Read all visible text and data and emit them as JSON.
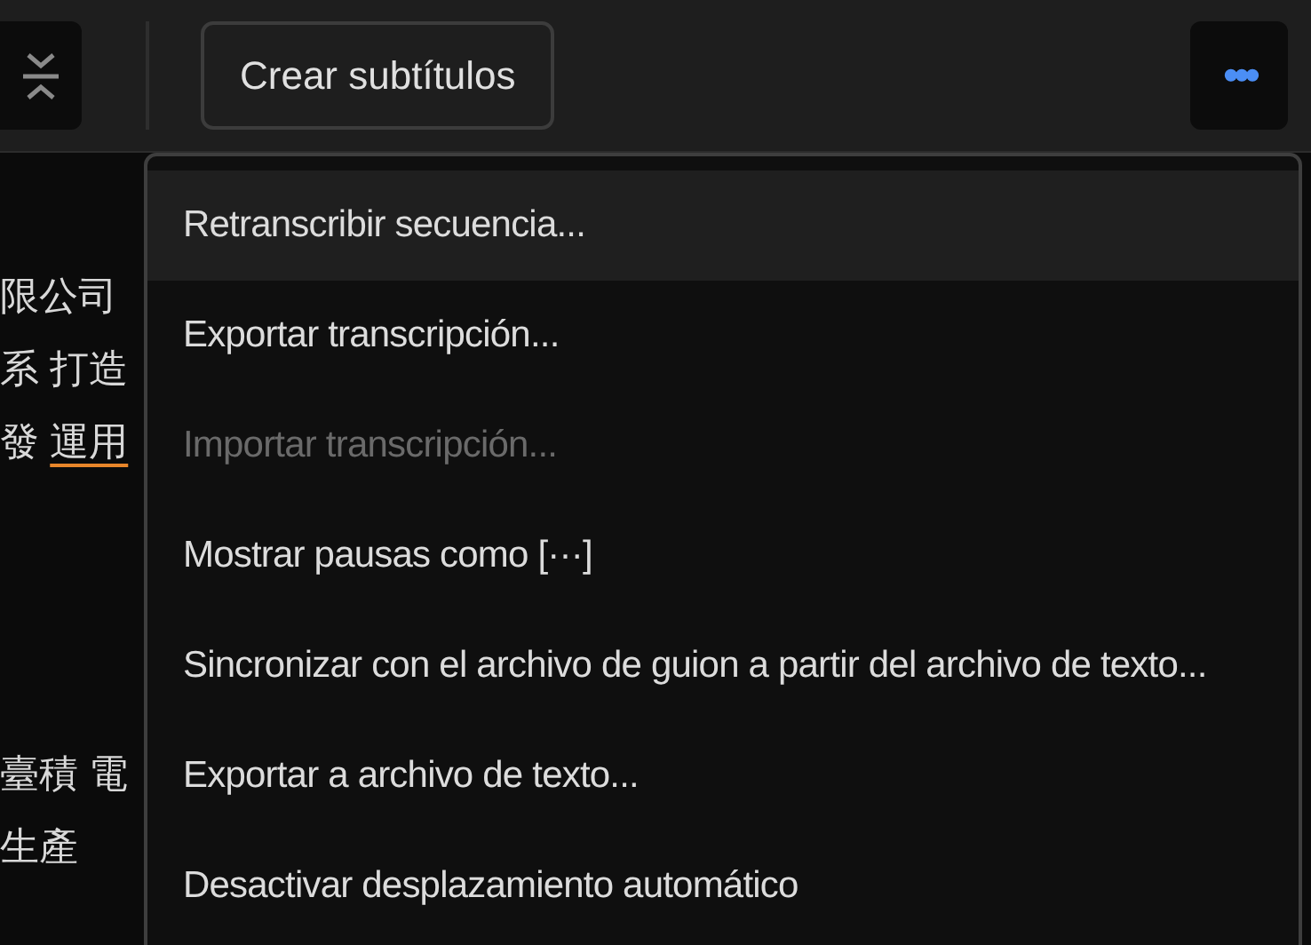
{
  "toolbar": {
    "create_captions_button": "Crear subtítulos",
    "more_button": "•••"
  },
  "transcript_lines": [
    {
      "parts": [
        {
          "text": "限公司",
          "underlined": false
        }
      ]
    },
    {
      "parts": [
        {
          "text": "系 打造",
          "underlined": false
        }
      ]
    },
    {
      "parts": [
        {
          "text": "發 ",
          "underlined": false
        },
        {
          "text": "運用",
          "underlined": true
        }
      ]
    },
    {
      "parts": [
        {
          "text": "臺積 電",
          "underlined": false
        }
      ]
    },
    {
      "parts": [
        {
          "text": "生產",
          "underlined": false
        }
      ]
    }
  ],
  "menu": {
    "items": [
      {
        "label": "Retranscribir secuencia...",
        "selected": true,
        "disabled": false
      },
      {
        "label": "Exportar transcripción...",
        "selected": false,
        "disabled": false
      },
      {
        "label": "Importar transcripción...",
        "selected": false,
        "disabled": true
      },
      {
        "label": "Mostrar pausas como [···]",
        "selected": false,
        "disabled": false
      },
      {
        "label": "Sincronizar con el archivo de guion a partir del archivo de texto...",
        "selected": false,
        "disabled": false
      },
      {
        "label": "Exportar a archivo de texto...",
        "selected": false,
        "disabled": false
      },
      {
        "label": "Desactivar desplazamiento automático",
        "selected": false,
        "disabled": false
      }
    ]
  }
}
